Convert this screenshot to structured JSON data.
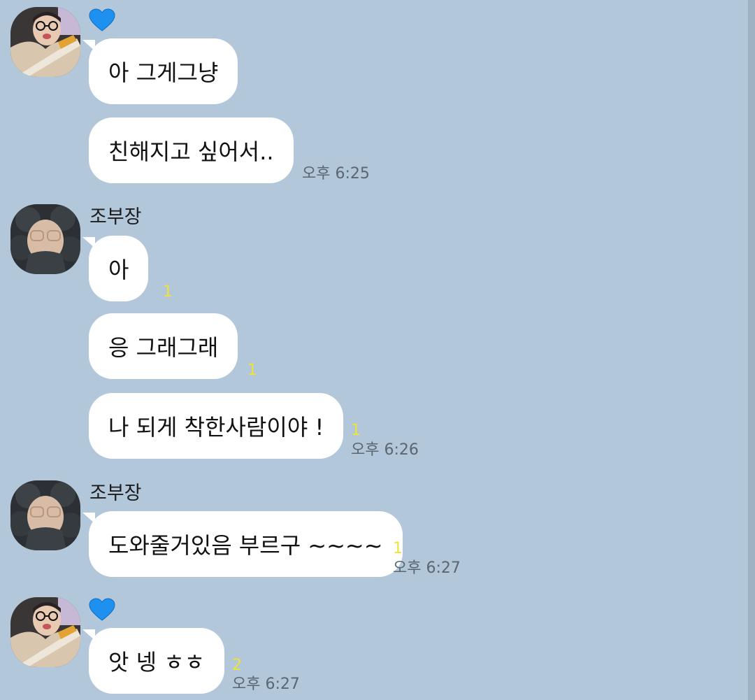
{
  "colors": {
    "background": "#b2c7da",
    "bubble": "#ffffff",
    "unread": "#f1e23a",
    "time": "#5c6670",
    "heart": "#1e90f0"
  },
  "icons": {
    "heart": "blue-heart-icon"
  },
  "messages": [
    {
      "sender": "",
      "text": "아 그게그냥",
      "unread": "",
      "time": ""
    },
    {
      "sender": "",
      "text": "친해지고 싶어서..",
      "unread": "",
      "time": "오후 6:25"
    },
    {
      "sender": "조부장",
      "text": "아",
      "unread": "1",
      "time": ""
    },
    {
      "sender": "",
      "text": "응 그래그래",
      "unread": "1",
      "time": ""
    },
    {
      "sender": "",
      "text": "나 되게 착한사람이야 !",
      "unread": "1",
      "time": "오후 6:26"
    },
    {
      "sender": "조부장",
      "text": "도와줄거있음 부르구 ~~~~",
      "unread": "1",
      "time": "오후 6:27"
    },
    {
      "sender": "",
      "text": "앗 넹 ㅎㅎ",
      "unread": "2",
      "time": "오후 6:27"
    }
  ]
}
